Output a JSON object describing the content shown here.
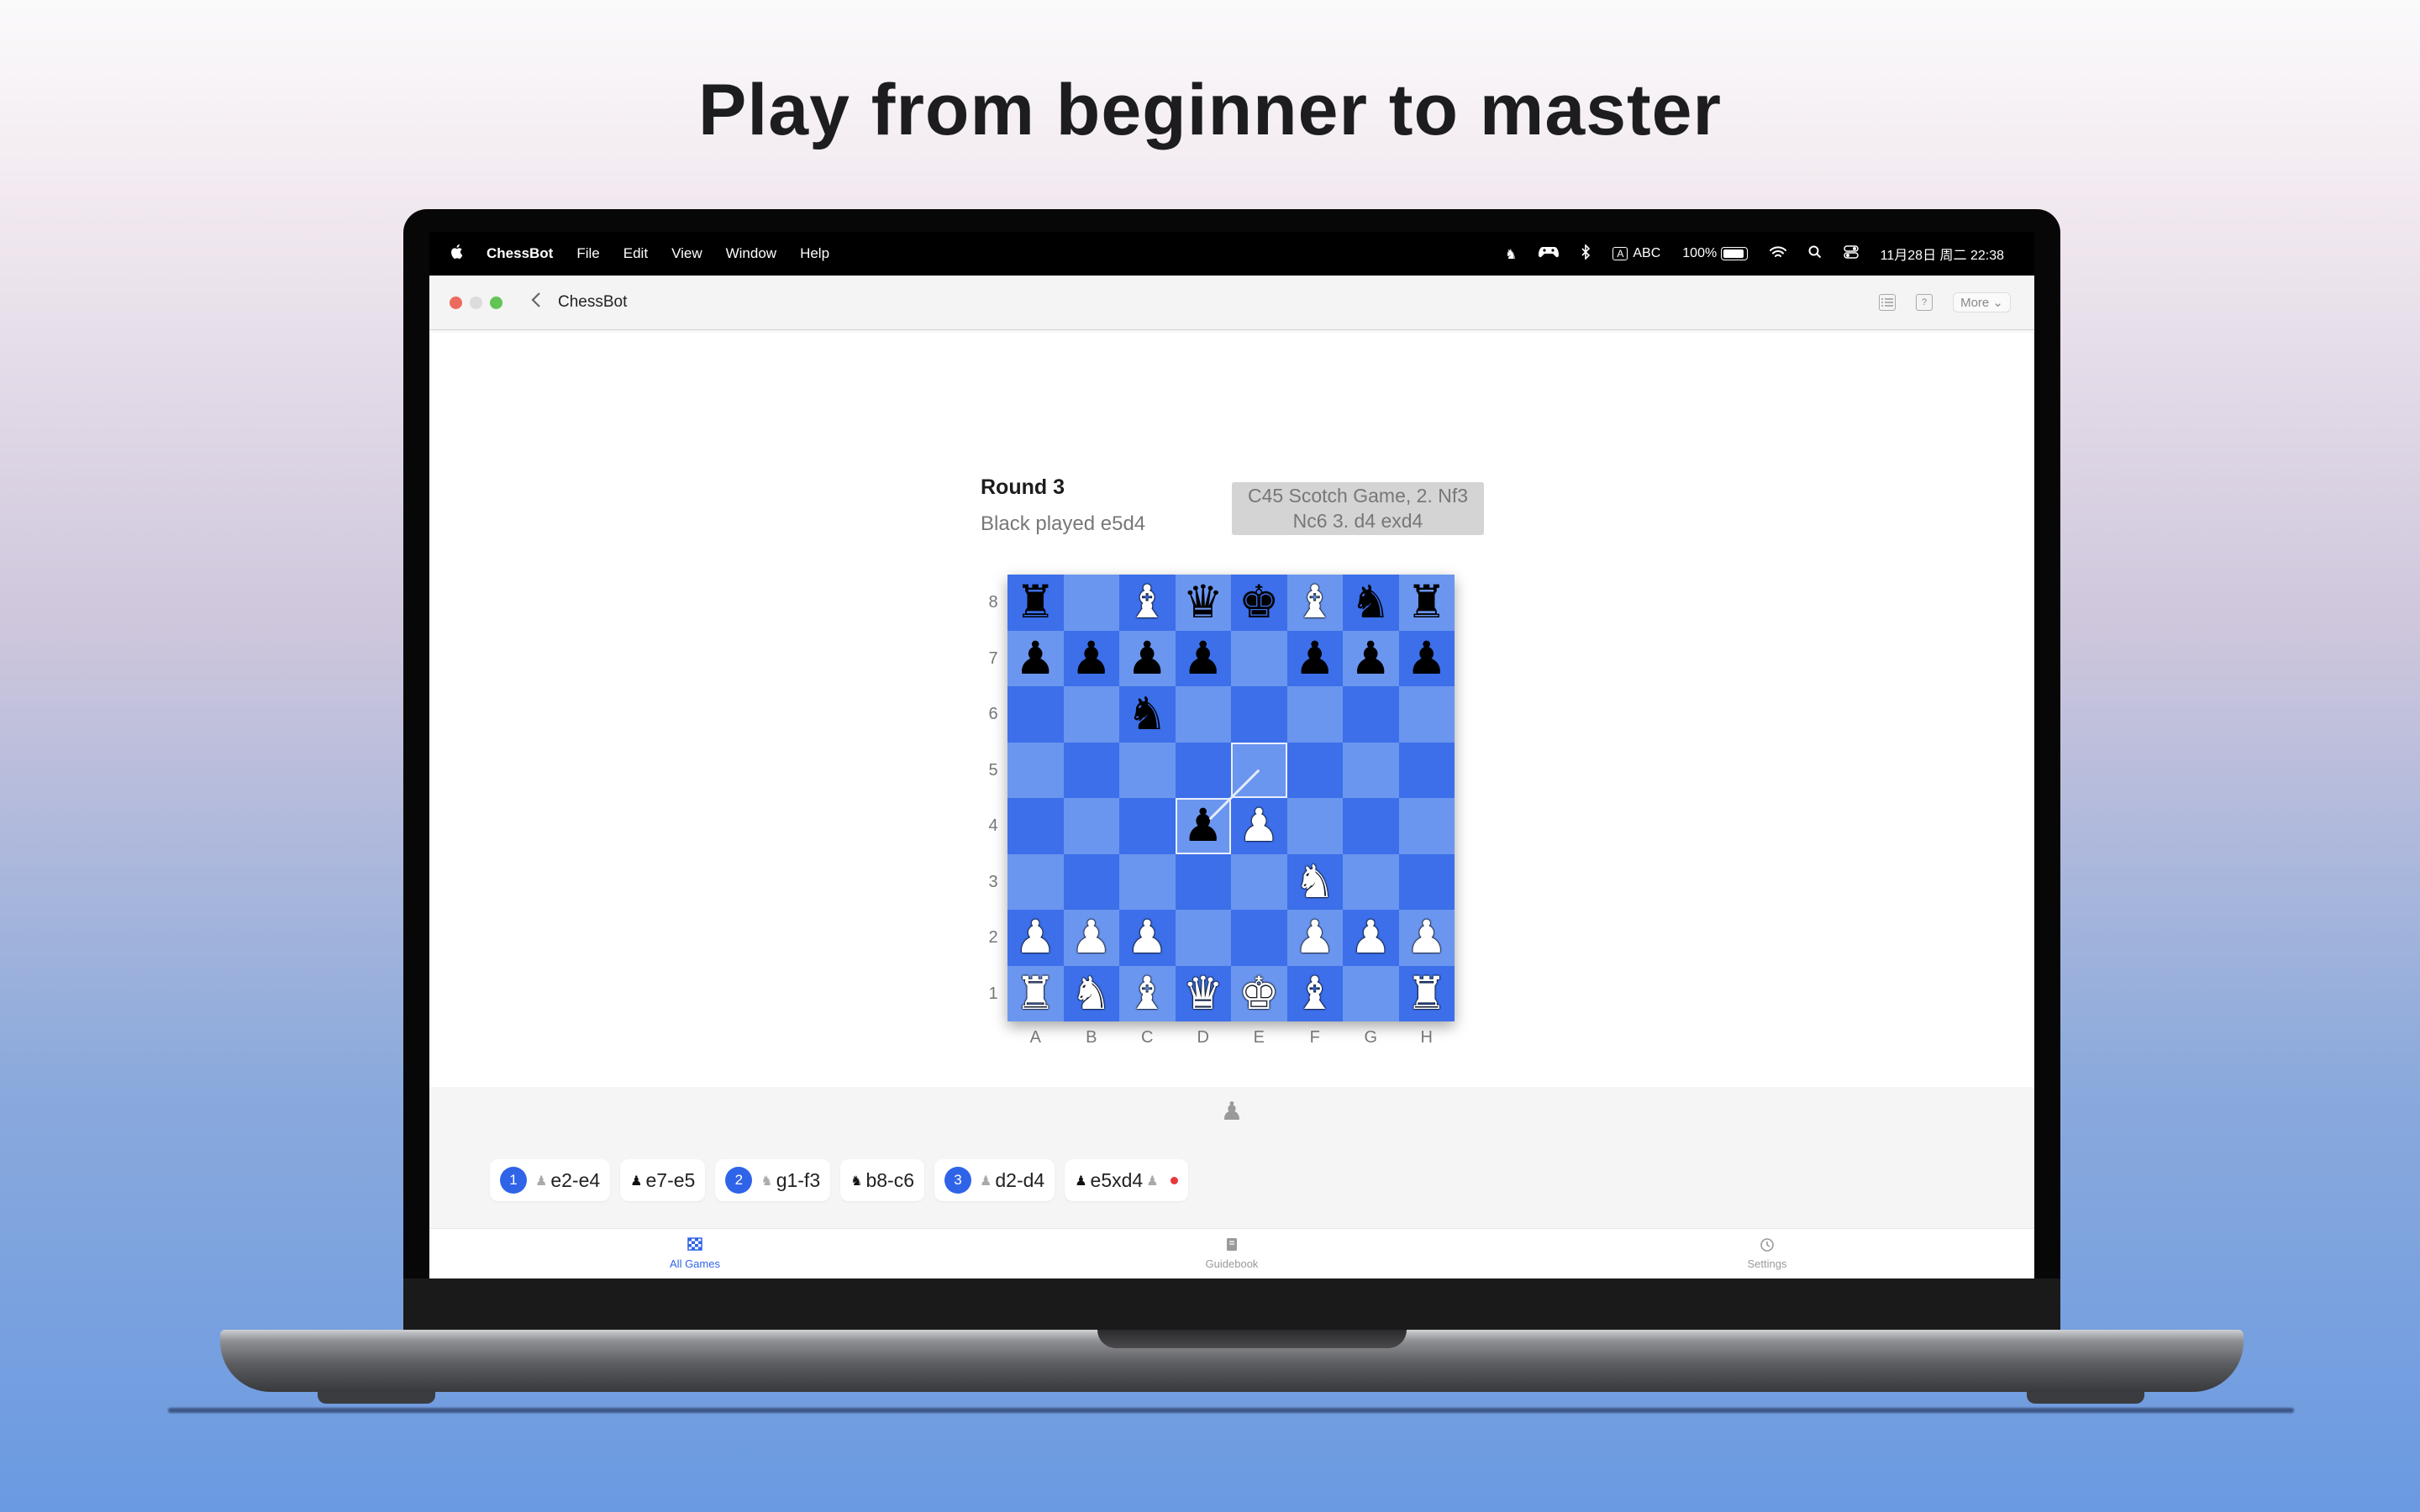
{
  "headline": "Play from beginner to master",
  "menubar": {
    "apple_icon": "",
    "app_name": "ChessBot",
    "items": [
      "File",
      "Edit",
      "View",
      "Window",
      "Help"
    ],
    "status": {
      "input_source_box": "A",
      "input_source": "ABC",
      "battery": "100%",
      "datetime": "11月28日 周二 22:38"
    }
  },
  "window": {
    "title": "ChessBot",
    "more_label": "More ⌄"
  },
  "game": {
    "round": "Round 3",
    "last_move": "Black played e5d4",
    "opening": "C45 Scotch Game, 2. Nf3 Nc6 3. d4 exd4",
    "ranks": [
      "8",
      "7",
      "6",
      "5",
      "4",
      "3",
      "2",
      "1"
    ],
    "files": [
      "A",
      "B",
      "C",
      "D",
      "E",
      "F",
      "G",
      "H"
    ],
    "board": [
      [
        "bR",
        "",
        "wB",
        "bQ",
        "bK",
        "wB",
        "bN",
        "bR"
      ],
      [
        "bP",
        "bP",
        "bP",
        "bP",
        "",
        "bP",
        "bP",
        "bP"
      ],
      [
        "",
        "",
        "bN",
        "",
        "",
        "",
        "",
        ""
      ],
      [
        "",
        "",
        "",
        "",
        "",
        "",
        "",
        ""
      ],
      [
        "",
        "",
        "",
        "bP",
        "wP",
        "",
        "",
        ""
      ],
      [
        "",
        "",
        "",
        "",
        "",
        "wN",
        "",
        ""
      ],
      [
        "wP",
        "wP",
        "wP",
        "",
        "",
        "wP",
        "wP",
        "wP"
      ],
      [
        "wR",
        "wN",
        "wB",
        "wQ",
        "wK",
        "wB",
        "",
        "wR"
      ]
    ],
    "highlight_squares": [
      "e5",
      "d4"
    ],
    "arrow": {
      "from": "e5",
      "to": "d4"
    },
    "turn_indicator": "♟"
  },
  "moves": [
    {
      "number": "1",
      "side": "w",
      "text": "e2-e4"
    },
    {
      "number": "",
      "side": "b",
      "text": "e7-e5"
    },
    {
      "number": "2",
      "side": "w",
      "text": "g1-f3",
      "piece": "N"
    },
    {
      "number": "",
      "side": "b",
      "text": "b8-c6",
      "piece": "N"
    },
    {
      "number": "3",
      "side": "w",
      "text": "d2-d4"
    },
    {
      "number": "",
      "side": "b",
      "text": "e5xd4",
      "current": true
    }
  ],
  "tabs": [
    {
      "label": "All Games",
      "icon": "grid-icon",
      "active": true
    },
    {
      "label": "Guidebook",
      "icon": "book-icon",
      "active": false
    },
    {
      "label": "Settings",
      "icon": "settings-icon",
      "active": false
    }
  ],
  "colors": {
    "light_square": "#6b96ef",
    "dark_square": "#3c6fe9",
    "accent": "#2f64e8"
  }
}
